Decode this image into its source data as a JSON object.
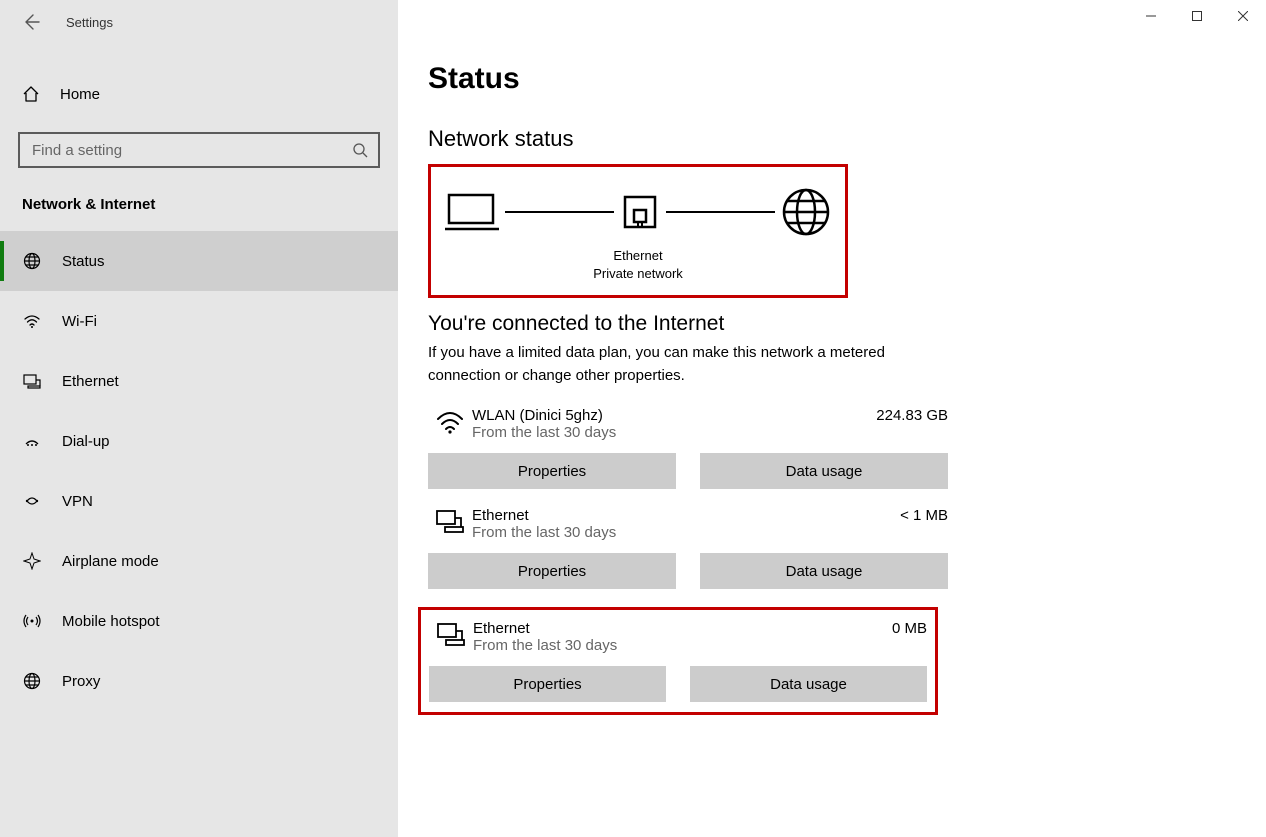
{
  "window": {
    "title": "Settings"
  },
  "sidebar": {
    "home_label": "Home",
    "search_placeholder": "Find a setting",
    "category": "Network & Internet",
    "items": [
      {
        "label": "Status"
      },
      {
        "label": "Wi-Fi"
      },
      {
        "label": "Ethernet"
      },
      {
        "label": "Dial-up"
      },
      {
        "label": "VPN"
      },
      {
        "label": "Airplane mode"
      },
      {
        "label": "Mobile hotspot"
      },
      {
        "label": "Proxy"
      }
    ]
  },
  "main": {
    "page_title": "Status",
    "section_title": "Network status",
    "diagram": {
      "adapter": "Ethernet",
      "profile": "Private network"
    },
    "connected_title": "You're connected to the Internet",
    "connected_sub": "If you have a limited data plan, you can make this network a metered connection or change other properties.",
    "buttons": {
      "properties": "Properties",
      "data_usage": "Data usage"
    },
    "networks": [
      {
        "name": "WLAN (Dinici 5ghz)",
        "sub": "From the last 30 days",
        "data": "224.83 GB",
        "icon": "wifi"
      },
      {
        "name": "Ethernet",
        "sub": "From the last 30 days",
        "data": "< 1 MB",
        "icon": "ethernet"
      },
      {
        "name": "Ethernet",
        "sub": "From the last 30 days",
        "data": "0 MB",
        "icon": "ethernet"
      }
    ]
  }
}
